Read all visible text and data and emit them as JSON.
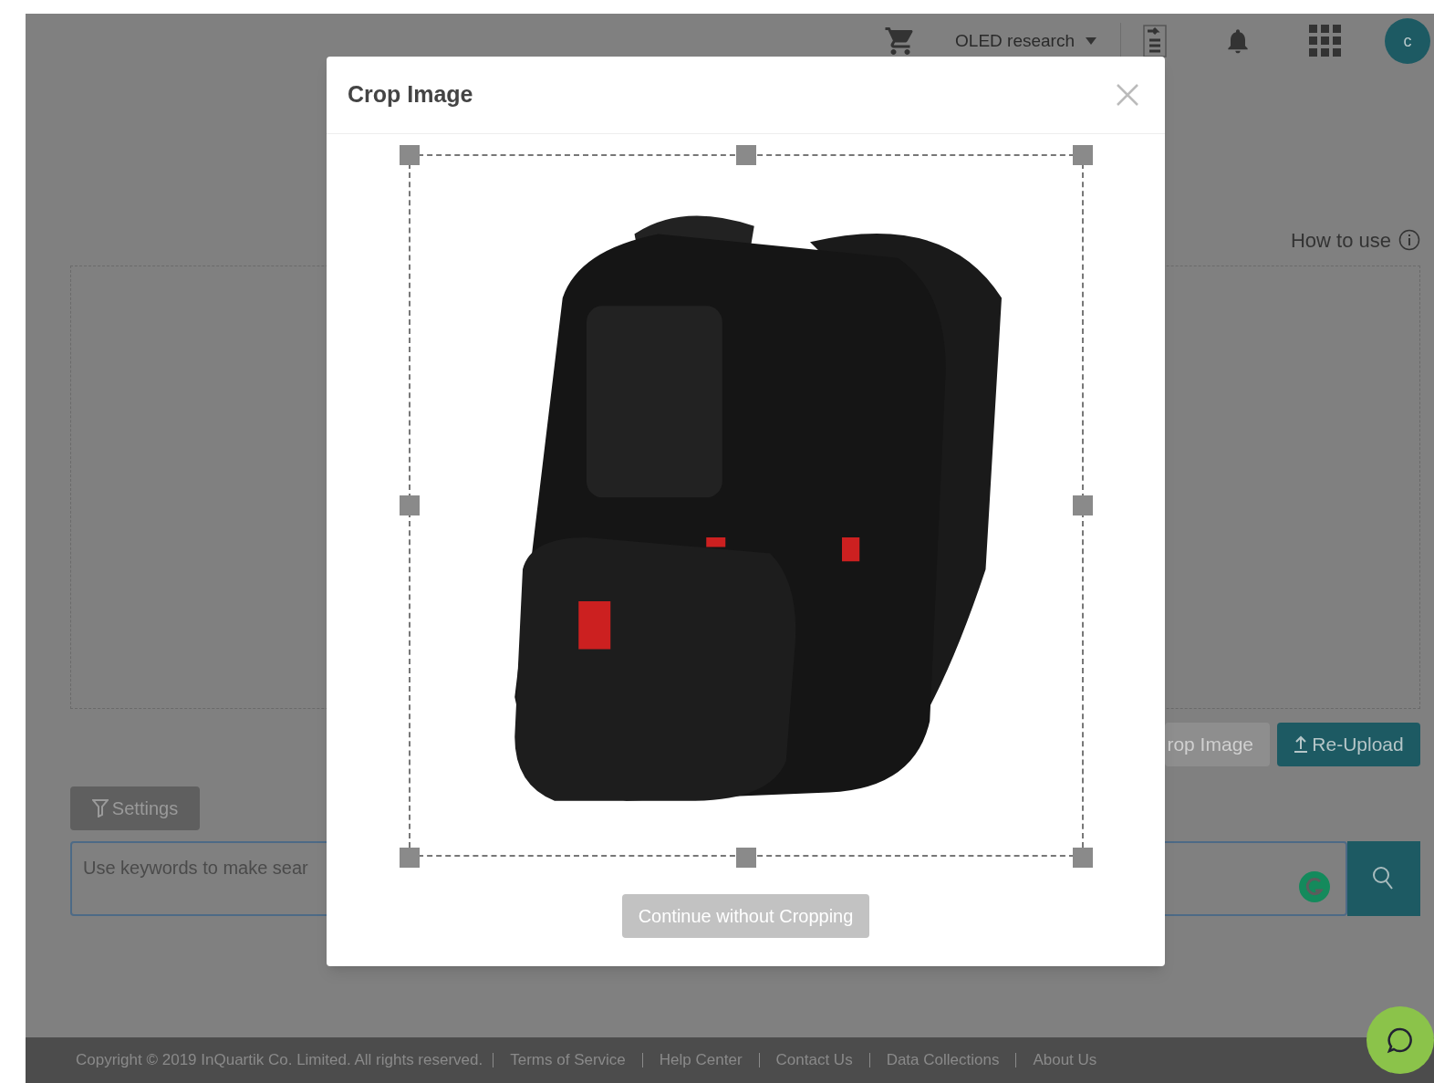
{
  "header": {
    "project": "OLED research",
    "avatar": "c"
  },
  "upload": {
    "help_link": "How to use",
    "buttons": [
      {
        "label": "rop Image",
        "kind": "secondary"
      },
      {
        "label": "Re-Upload",
        "kind": "primary"
      }
    ]
  },
  "search": {
    "settings_button": "Settings",
    "placeholder": "Use keywords to make sear"
  },
  "footer": {
    "copyright": "Copyright © 2019 InQuartik Co. Limited. All rights reserved.",
    "links": [
      "Terms of Service",
      "Help Center",
      "Contact Us",
      "Data Collections",
      "About Us"
    ]
  },
  "modal": {
    "title": "Crop Image",
    "continue_button": "Continue without Cropping"
  }
}
